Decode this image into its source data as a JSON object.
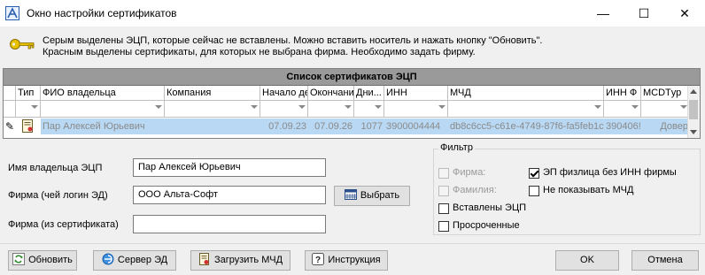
{
  "window": {
    "title": "Окно настройки сертификатов",
    "minimize": "—",
    "maximize": "☐",
    "close": "✕"
  },
  "info": {
    "line1": "Серым выделены ЭЦП, которые сейчас не вставлены. Можно вставить носитель и нажать кнопку \"Обновить\".",
    "line2": "Красным выделены сертификаты, для которых не выбрана фирма. Необходимо задать фирму."
  },
  "grid": {
    "caption": "Список сертификатов ЭЦП",
    "columns": [
      "Тип",
      "ФИО владельца",
      "Компания",
      "Начало де",
      "Окончани",
      "Дни...",
      "ИНН",
      "МЧД",
      "ИНН Ф",
      "MCDTур"
    ],
    "row": {
      "marker": "✎",
      "fio": "Пар Алексей Юрьевич",
      "company": "",
      "start": "07.09.23",
      "end": "07.09.26",
      "days": "1077",
      "inn": "3900004444",
      "mchd": "db8c6cc5-c61e-4749-87f6-fa5feb1c",
      "inn_f": "390406!",
      "mcd_type": "Довер"
    }
  },
  "form": {
    "owner_label": "Имя владельца ЭЦП",
    "owner_value": "Пар Алексей Юрьевич",
    "firm_label": "Фирма (чей логин ЭД)",
    "firm_value": "ООО Альта-Софт",
    "select_button": "Выбрать",
    "cert_firm_label": "Фирма (из сертификата)",
    "cert_firm_value": ""
  },
  "filter": {
    "title": "Фильтр",
    "firm": "Фирма:",
    "surname": "Фамилия:",
    "inserted": "Вставлены ЭЦП",
    "expired": "Просроченные",
    "ep_fizlica": "ЭП физлица без ИНН фирмы",
    "hide_mchd": "Не показывать МЧД"
  },
  "buttons": {
    "refresh": "Обновить",
    "server": "Сервер ЭД",
    "load_mchd": "Загрузить МЧД",
    "instruction": "Инструкция",
    "ok": "OK",
    "cancel": "Отмена"
  },
  "colors": {
    "selected_row": "#b9d8f3",
    "caption_bar": "#9a9a9a",
    "grey_text": "#8a8a8a"
  }
}
